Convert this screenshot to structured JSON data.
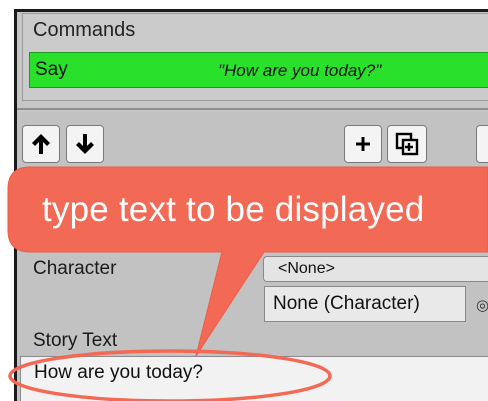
{
  "commands": {
    "title": "Commands",
    "rows": [
      {
        "name": "Say",
        "summary": "\"How are you today?\""
      }
    ]
  },
  "toolbar": {
    "move_up_icon": "arrow-up-icon",
    "move_down_icon": "arrow-down-icon",
    "add_icon": "plus-icon",
    "duplicate_icon": "duplicate-icon"
  },
  "fields": {
    "character_label": "Character",
    "character_value": "<None>",
    "character_object": "None (Character)",
    "story_text_label": "Story Text",
    "story_text_value": "How are you today?"
  },
  "annotation": {
    "text": "type text to be displayed"
  },
  "colors": {
    "command_row": "#29e02b",
    "callout": "#f26a55"
  }
}
